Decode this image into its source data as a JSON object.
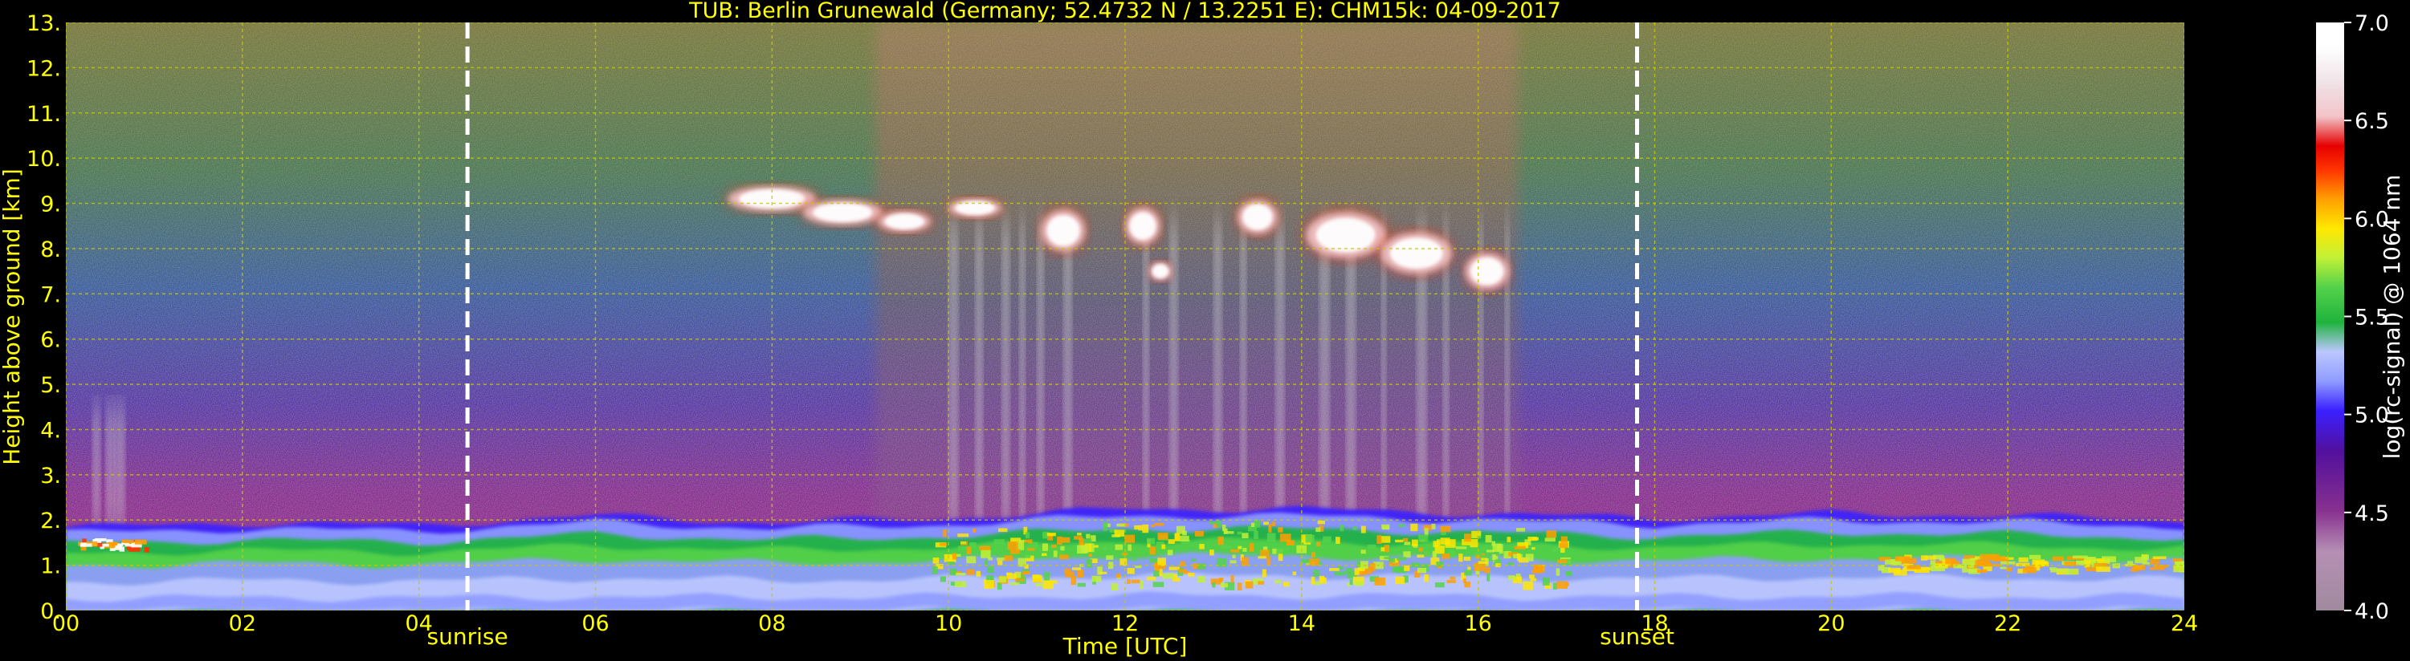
{
  "chart_data": {
    "type": "heatmap",
    "title": "TUB: Berlin Grunewald (Germany; 52.4732 N / 13.2251 E):    CHM15k: 04-09-2017",
    "xlabel": "Time [UTC]",
    "ylabel": "Height above ground [km]",
    "xlim": [
      0,
      24
    ],
    "ylim": [
      0,
      13
    ],
    "x_ticks": [
      "00",
      "02",
      "04",
      "06",
      "08",
      "10",
      "12",
      "14",
      "16",
      "18",
      "20",
      "22",
      "24"
    ],
    "y_ticks": [
      "0.",
      "1.",
      "2.",
      "3.",
      "4.",
      "5.",
      "6.",
      "7.",
      "8.",
      "9.",
      "10.",
      "11.",
      "12.",
      "13."
    ],
    "grid": true,
    "colorbar": {
      "label": "log(rc-signal) @ 1064 nm",
      "range": [
        4.0,
        7.0
      ],
      "ticks": [
        "4.0",
        "4.5",
        "5.0",
        "5.5",
        "6.0",
        "6.5",
        "7.0"
      ]
    },
    "annotations": [
      {
        "text": "sunrise",
        "x": 4.55
      },
      {
        "text": "sunset",
        "x": 17.8
      }
    ],
    "features": {
      "boundary_layer_top_km": [
        [
          0,
          1.8
        ],
        [
          2,
          1.9
        ],
        [
          4,
          1.85
        ],
        [
          6,
          2.05
        ],
        [
          8,
          1.9
        ],
        [
          10,
          2.0
        ],
        [
          12,
          2.2
        ],
        [
          14,
          2.2
        ],
        [
          16,
          2.1
        ],
        [
          18,
          2.0
        ],
        [
          20,
          2.1
        ],
        [
          22,
          2.05
        ],
        [
          24,
          1.95
        ]
      ],
      "cirrus_cloud_layer": {
        "x": [
          7.5,
          16.5
        ],
        "y_km": [
          7.1,
          9.6
        ]
      }
    }
  },
  "colors": {
    "frame": "#000000",
    "axis_text": "#ffff00",
    "colorbar_text": "#ffffff",
    "grid": "#c8c800",
    "sun_lines": "#ffffff",
    "colormap": [
      "#a08a9e",
      "#b58fb4",
      "#87308f",
      "#52109c",
      "#3a20ff",
      "#8f9cff",
      "#bcc7ff",
      "#1fb33d",
      "#55d24a",
      "#c2f036",
      "#ffe800",
      "#ff9f00",
      "#ff3300",
      "#e60000",
      "#f2c4c8",
      "#f0e4e8",
      "#ffffff"
    ]
  }
}
